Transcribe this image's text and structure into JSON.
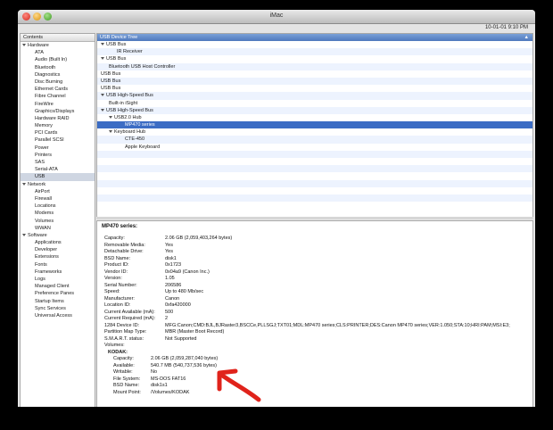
{
  "window": {
    "title": "iMac",
    "timestamp": "10-01-01 9:10 PM"
  },
  "sidebar": {
    "header": "Contents",
    "rows": [
      {
        "label": "Hardware",
        "type": "group"
      },
      {
        "label": "ATA",
        "type": "item"
      },
      {
        "label": "Audio (Built In)",
        "type": "item"
      },
      {
        "label": "Bluetooth",
        "type": "item"
      },
      {
        "label": "Diagnostics",
        "type": "item"
      },
      {
        "label": "Disc Burning",
        "type": "item"
      },
      {
        "label": "Ethernet Cards",
        "type": "item"
      },
      {
        "label": "Fibre Channel",
        "type": "item"
      },
      {
        "label": "FireWire",
        "type": "item"
      },
      {
        "label": "Graphics/Displays",
        "type": "item"
      },
      {
        "label": "Hardware RAID",
        "type": "item"
      },
      {
        "label": "Memory",
        "type": "item"
      },
      {
        "label": "PCI Cards",
        "type": "item"
      },
      {
        "label": "Parallel SCSI",
        "type": "item"
      },
      {
        "label": "Power",
        "type": "item"
      },
      {
        "label": "Printers",
        "type": "item"
      },
      {
        "label": "SAS",
        "type": "item"
      },
      {
        "label": "Serial-ATA",
        "type": "item"
      },
      {
        "label": "USB",
        "type": "item",
        "selected": true
      },
      {
        "label": "Network",
        "type": "group"
      },
      {
        "label": "AirPort",
        "type": "item"
      },
      {
        "label": "Firewall",
        "type": "item"
      },
      {
        "label": "Locations",
        "type": "item"
      },
      {
        "label": "Modems",
        "type": "item"
      },
      {
        "label": "Volumes",
        "type": "item"
      },
      {
        "label": "WWAN",
        "type": "item"
      },
      {
        "label": "Software",
        "type": "group"
      },
      {
        "label": "Applications",
        "type": "item"
      },
      {
        "label": "Developer",
        "type": "item"
      },
      {
        "label": "Extensions",
        "type": "item"
      },
      {
        "label": "Fonts",
        "type": "item"
      },
      {
        "label": "Frameworks",
        "type": "item"
      },
      {
        "label": "Logs",
        "type": "item"
      },
      {
        "label": "Managed Client",
        "type": "item"
      },
      {
        "label": "Preference Panes",
        "type": "item"
      },
      {
        "label": "Startup Items",
        "type": "item"
      },
      {
        "label": "Sync Services",
        "type": "item"
      },
      {
        "label": "Universal Access",
        "type": "item"
      }
    ]
  },
  "device_tree": {
    "header": "USB Device Tree",
    "rows": [
      {
        "label": "USB Bus",
        "level": 0,
        "expanded": true
      },
      {
        "label": "IR Receiver",
        "level": 2
      },
      {
        "label": "USB Bus",
        "level": 0,
        "expanded": true
      },
      {
        "label": "Bluetooth USB Host Controller",
        "level": 1
      },
      {
        "label": "USB Bus",
        "level": 0
      },
      {
        "label": "USB Bus",
        "level": 0
      },
      {
        "label": "USB Bus",
        "level": 0
      },
      {
        "label": "USB High-Speed Bus",
        "level": 0,
        "expanded": true
      },
      {
        "label": "Built-in iSight",
        "level": 1
      },
      {
        "label": "USB High-Speed Bus",
        "level": 0,
        "expanded": true
      },
      {
        "label": "USB2.0 Hub",
        "level": 1,
        "expanded": true
      },
      {
        "label": "MP470 series",
        "level": 3,
        "selected": true
      },
      {
        "label": "Keyboard Hub",
        "level": 1,
        "expanded": true
      },
      {
        "label": "CTE-450",
        "level": 3
      },
      {
        "label": "Apple Keyboard",
        "level": 3
      },
      {
        "label": "",
        "level": 0
      },
      {
        "label": "",
        "level": 0
      },
      {
        "label": "",
        "level": 0
      },
      {
        "label": "",
        "level": 0
      },
      {
        "label": "",
        "level": 0
      },
      {
        "label": "",
        "level": 0
      },
      {
        "label": "",
        "level": 0
      },
      {
        "label": "",
        "level": 0
      }
    ]
  },
  "detail": {
    "title": "MP470 series:",
    "fields": [
      {
        "k": "Capacity:",
        "v": "2.06 GB (2,059,403,264 bytes)"
      },
      {
        "k": "Removable Media:",
        "v": "Yes"
      },
      {
        "k": "Detachable Drive:",
        "v": "Yes"
      },
      {
        "k": "BSD Name:",
        "v": "disk1"
      },
      {
        "k": "Product ID:",
        "v": "0x1723"
      },
      {
        "k": "Vendor ID:",
        "v": "0x04a9  (Canon Inc.)"
      },
      {
        "k": "Version:",
        "v": " 1.05"
      },
      {
        "k": "Serial Number:",
        "v": "206586"
      },
      {
        "k": "Speed:",
        "v": "Up to 480 Mb/sec"
      },
      {
        "k": "Manufacturer:",
        "v": "Canon"
      },
      {
        "k": "Location ID:",
        "v": "0xfa420000"
      },
      {
        "k": "Current Available (mA):",
        "v": "500"
      },
      {
        "k": "Current Required (mA):",
        "v": "2"
      },
      {
        "k": "1284 Device ID:",
        "v": "MFG:Canon;CMD:BJL,BJRaster3,BSCCe,PLLSGJ;TXT01;MDL:MP470 series;CLS:PRINTER;DES:Canon MP470 series;VER:1.050;STA:10;HRI:PAM;MSI:E3;"
      },
      {
        "k": "Partition Map Type:",
        "v": "MBR (Master Boot Record)"
      },
      {
        "k": "S.M.A.R.T. status:",
        "v": "Not Supported"
      },
      {
        "k": "Volumes:",
        "v": ""
      }
    ],
    "volume_name": "KODAK:",
    "volume_fields": [
      {
        "k": "Capacity:",
        "v": "2.06 GB (2,059,287,040 bytes)"
      },
      {
        "k": "Available:",
        "v": "540.7 MB (540,737,536 bytes)"
      },
      {
        "k": "Writable:",
        "v": "No"
      },
      {
        "k": "File System:",
        "v": "MS-DOS FAT16"
      },
      {
        "k": "BSD Name:",
        "v": "disk1s1"
      },
      {
        "k": "Mount Point:",
        "v": "/Volumes/KODAK"
      }
    ]
  },
  "annotation": {
    "arrow_color": "#e0231b"
  }
}
